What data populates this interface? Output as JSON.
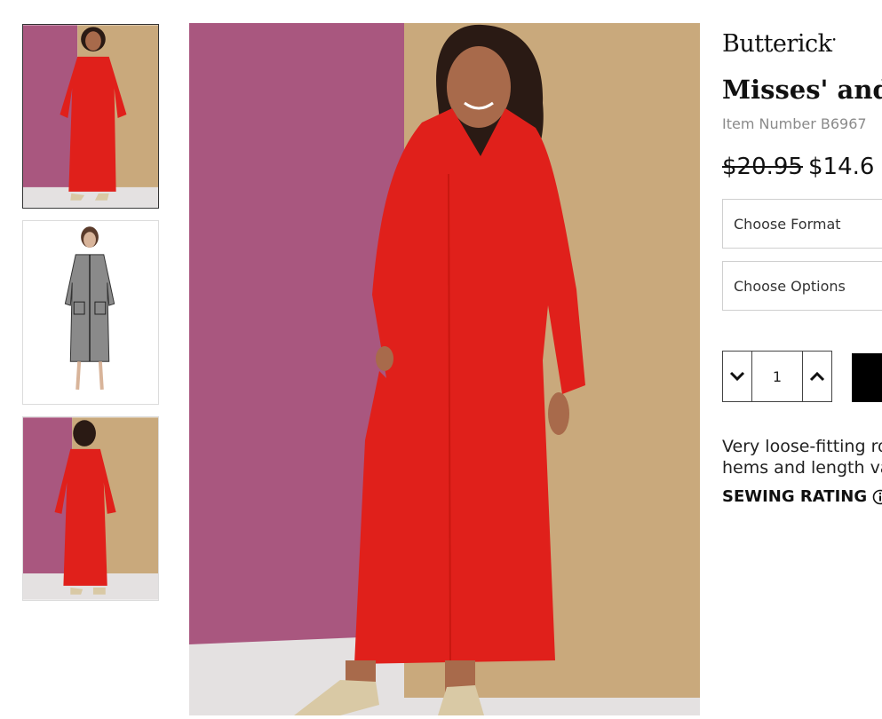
{
  "product": {
    "brand": "Butterick",
    "brand_mark": "•",
    "title": "Misses' and",
    "item_number": "Item Number B6967",
    "price_original": "$20.95",
    "price_sale": "$14.6",
    "description_line1": "Very loose-fitting ro",
    "description_line2": "hems and length va",
    "sewing_rating_label": "SEWING RATING"
  },
  "selectors": {
    "format_label": "Choose Format",
    "options_label": "Choose Options"
  },
  "quantity": {
    "value": "1"
  },
  "gallery": {
    "thumbnails": [
      "model-front-photo",
      "line-drawing-sketch",
      "model-back-photo"
    ],
    "active_index": 0
  },
  "colors": {
    "robe_red": "#e0201b",
    "wall_purple": "#a9577f",
    "wall_tan": "#c9a97c",
    "floor": "#e4e1e1"
  }
}
